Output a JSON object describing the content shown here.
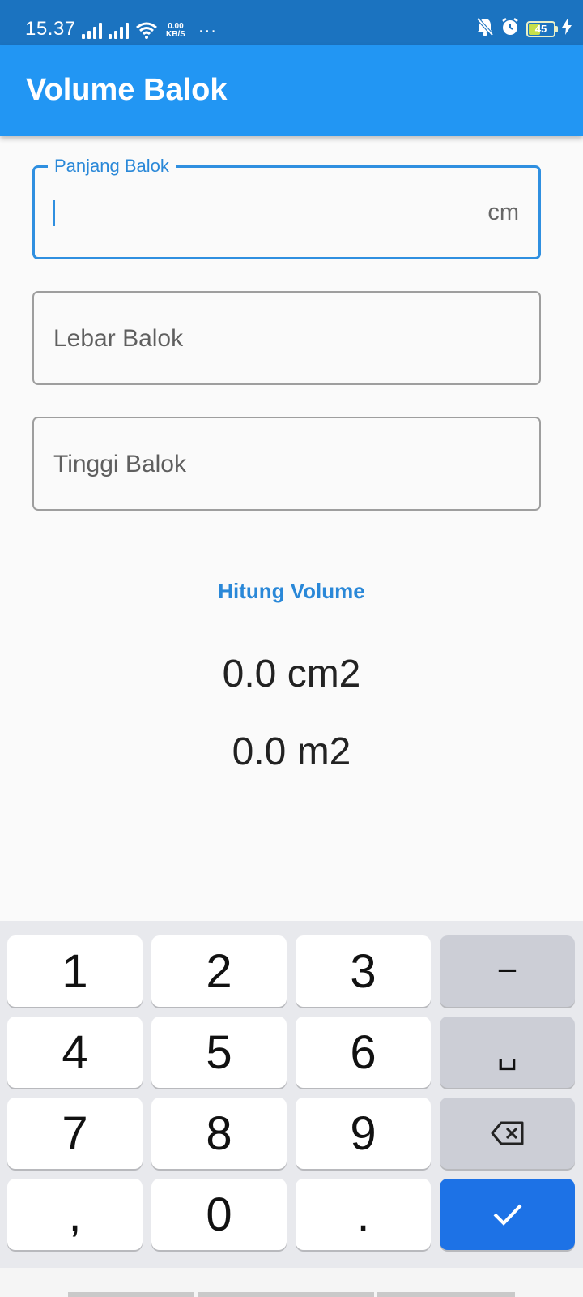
{
  "status_bar": {
    "time": "15.37",
    "net_speed_value": "0.00",
    "net_speed_unit": "KB/S",
    "more": "···",
    "battery": "45"
  },
  "app_bar": {
    "title": "Volume Balok"
  },
  "form": {
    "panjang": {
      "label": "Panjang Balok",
      "suffix": "cm",
      "value": ""
    },
    "lebar": {
      "placeholder": "Lebar Balok"
    },
    "tinggi": {
      "placeholder": "Tinggi Balok"
    }
  },
  "action": {
    "label": "Hitung Volume"
  },
  "results": {
    "cm": "0.0 cm2",
    "m": "0.0 m2"
  },
  "keyboard": {
    "keys": [
      "1",
      "2",
      "3",
      "−",
      "4",
      "5",
      "6",
      "␣",
      "7",
      "8",
      "9",
      "⌫",
      ",",
      "0",
      ".",
      "✓"
    ]
  },
  "colors": {
    "status_bar": "#1b73c0",
    "app_bar": "#2296f3",
    "accent": "#2a88d8",
    "enter_key": "#1d72e6"
  }
}
